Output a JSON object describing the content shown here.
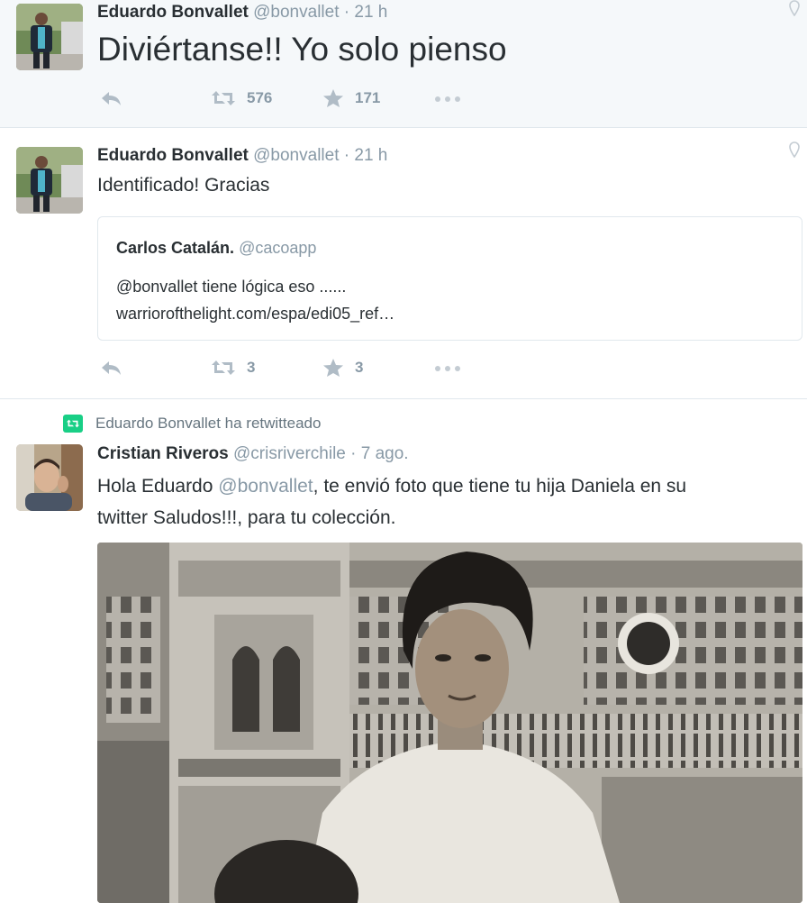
{
  "tweets": [
    {
      "name": "Eduardo Bonvallet",
      "handle": "@bonvallet",
      "time": "· 21 h",
      "text": "Diviértanse!! Yo solo pienso",
      "retweets": "576",
      "favorites": "171"
    },
    {
      "name": "Eduardo Bonvallet",
      "handle": "@bonvallet",
      "time": "· 21 h",
      "text": "Identificado! Gracias",
      "quote": {
        "name": "Carlos Catalán.",
        "handle": "@cacoapp",
        "line1": "@bonvallet tiene lógica eso ......",
        "line2": "warriorofthelight.com/espa/edi05_ref…"
      },
      "retweets": "3",
      "favorites": "3"
    },
    {
      "retweeted_by": "Eduardo Bonvallet ha retwitteado",
      "name": "Cristian Riveros",
      "handle": "@crisriverchile",
      "time": "· 7 ago.",
      "text_before": "Hola Eduardo ",
      "mention": "@bonvallet",
      "text_after": ", te envió foto que tiene tu hija Daniela en su",
      "text_line2": "twitter Saludos!!!, para tu colección."
    }
  ],
  "colors": {
    "link": "#8899a6",
    "retweet_green": "#19cf86",
    "selected_bg": "#f5f8fa"
  },
  "icons": [
    "reply-icon",
    "retweet-icon",
    "favorite-icon",
    "more-icon",
    "geo-pin-icon"
  ]
}
